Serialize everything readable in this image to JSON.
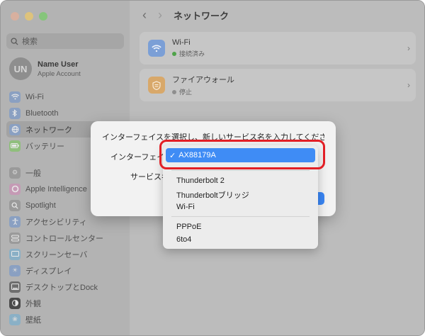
{
  "search": {
    "placeholder": "検索"
  },
  "account": {
    "initials": "UN",
    "name": "Name User",
    "subtitle": "Apple Account"
  },
  "sidebar": {
    "items": [
      {
        "label": "Wi-Fi",
        "icon": "wifi-icon",
        "color": "#8aa0c2"
      },
      {
        "label": "Bluetooth",
        "icon": "bluetooth-icon",
        "color": "#8aa0c2"
      },
      {
        "label": "ネットワーク",
        "icon": "network-icon",
        "color": "#8aa0c2",
        "selected": true
      },
      {
        "label": "バッテリー",
        "icon": "battery-icon",
        "color": "#8fbf7c"
      },
      {
        "label": "一般",
        "icon": "gear-icon",
        "color": "#9a9a9a"
      },
      {
        "label": "Apple Intelligence",
        "icon": "apple-intelligence-icon",
        "color": "#c59ab5"
      },
      {
        "label": "Spotlight",
        "icon": "spotlight-icon",
        "color": "#9a9a9a"
      },
      {
        "label": "アクセシビリティ",
        "icon": "accessibility-icon",
        "color": "#8aa0c2"
      },
      {
        "label": "コントロールセンター",
        "icon": "control-center-icon",
        "color": "#9a9a9a"
      },
      {
        "label": "スクリーンセーバ",
        "icon": "screensaver-icon",
        "color": "#8ab0c6"
      },
      {
        "label": "ディスプレイ",
        "icon": "display-icon",
        "color": "#8aa0c2"
      },
      {
        "label": "デスクトップとDock",
        "icon": "dock-icon",
        "color": "#6e6e6e"
      },
      {
        "label": "外観",
        "icon": "appearance-icon",
        "color": "#4a4a4a"
      },
      {
        "label": "壁紙",
        "icon": "wallpaper-icon",
        "color": "#8ab0c6"
      }
    ]
  },
  "toolbar": {
    "title": "ネットワーク"
  },
  "services": [
    {
      "name": "Wi-Fi",
      "status": "接続済み",
      "status_color": "#4fa34a",
      "icon": "wifi-icon",
      "icon_color": "#7b9fd6"
    },
    {
      "name": "ファイアウォール",
      "status": "停止",
      "status_color": "#8e8e8e",
      "icon": "firewall-icon",
      "icon_color": "#d8a86a"
    }
  ],
  "controls": {
    "more_label": "···",
    "help_label": "?"
  },
  "modal": {
    "message": "インターフェイスを選択し、新しいサービス名を入力してください。",
    "interface_label": "インターフェイス:",
    "service_name_label": "サービス名:"
  },
  "dropdown": {
    "selected": "AX88179A",
    "options_group1": [
      "Thunderbolt 2",
      "Thunderboltブリッジ",
      "Wi-Fi"
    ],
    "options_group2": [
      "PPPoE",
      "6to4"
    ]
  }
}
